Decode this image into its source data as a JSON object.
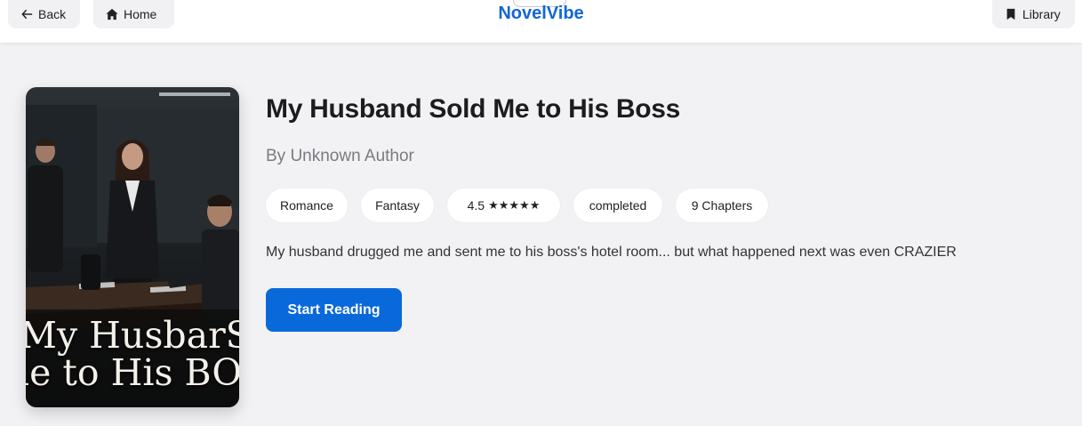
{
  "header": {
    "back_label": "Back",
    "home_label": "Home",
    "brand": "NovelVibe",
    "library_label": "Library",
    "back_icon": "arrow-left-icon",
    "home_icon": "home-icon",
    "library_icon": "bookmark-icon"
  },
  "book": {
    "title": "My Husband Sold Me to His Boss",
    "author": "By Unknown Author",
    "cover_text_line1": "My HusbarSold",
    "cover_text_line2": "le to His BOS",
    "tags": {
      "genre1": "Romance",
      "genre2": "Fantasy",
      "rating": "4.5",
      "stars": "★★★★★",
      "status": "completed",
      "chapters": "9 Chapters"
    },
    "description": "My husband drugged me and sent me to his boss's hotel room... but what happened next was even CRAZIER",
    "start_label": "Start Reading"
  },
  "colors": {
    "brand": "#1166d6",
    "primary_button": "#0a69da",
    "background": "#f2f2f5"
  }
}
